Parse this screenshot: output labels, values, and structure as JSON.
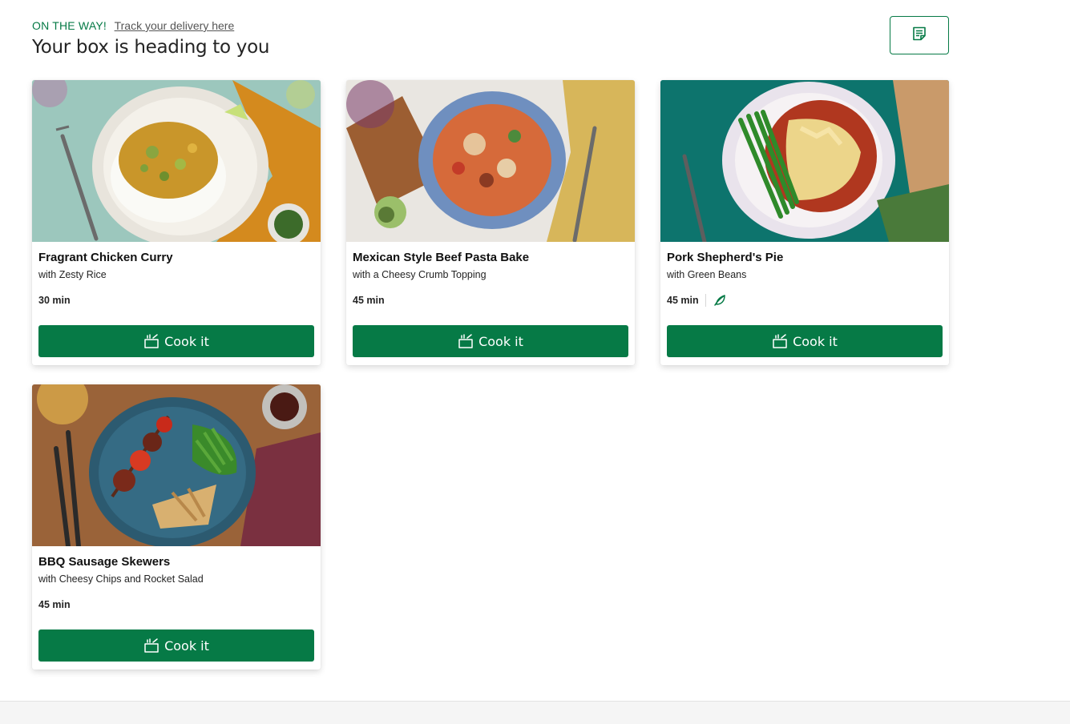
{
  "header": {
    "status_label": "ON THE WAY!",
    "track_link": "Track your delivery here",
    "title": "Your box is heading to you",
    "recipes_icon": "recipe-card-icon"
  },
  "cook_label": "Cook it",
  "recipes": [
    {
      "title": "Fragrant Chicken Curry",
      "subtitle": "with Zesty Rice",
      "time": "30 min",
      "eco_badge": false
    },
    {
      "title": "Mexican Style Beef Pasta Bake",
      "subtitle": "with a Cheesy Crumb Topping",
      "time": "45 min",
      "eco_badge": false
    },
    {
      "title": "Pork Shepherd's Pie",
      "subtitle": "with Green Beans",
      "time": "45 min",
      "eco_badge": true
    },
    {
      "title": "BBQ Sausage Skewers",
      "subtitle": "with Cheesy Chips and Rocket Salad",
      "time": "45 min",
      "eco_badge": false
    }
  ],
  "colors": {
    "brand_green": "#067a46",
    "text": "#242424",
    "footer_bg": "#f5f5f5"
  }
}
